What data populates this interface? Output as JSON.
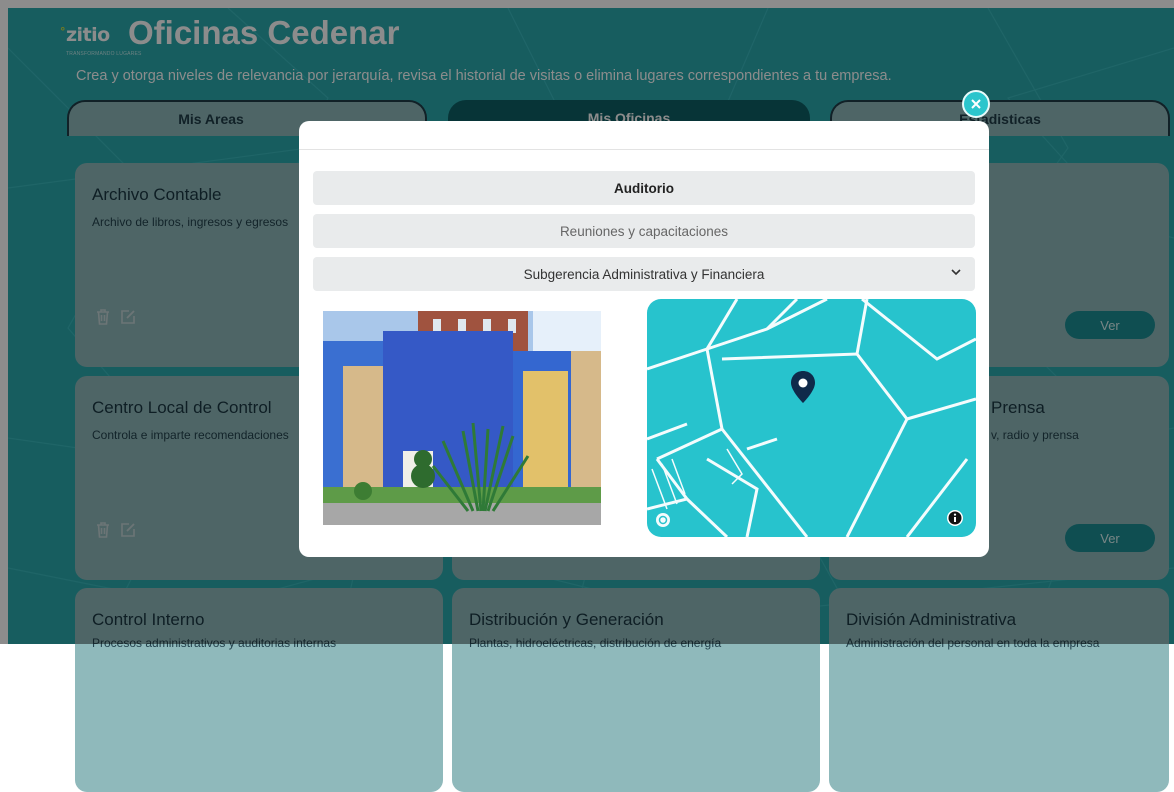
{
  "header": {
    "logo_text": "zitio",
    "logo_dot": "°",
    "logo_tagline": "TRANSFORMANDO LUGARES",
    "title": "Oficinas Cedenar",
    "subtitle": "Crea y otorga niveles de relevancia por jerarquía, revisa el historial de visitas o elimina lugares correspondientes a tu empresa."
  },
  "tabs": [
    {
      "label": "Mis Areas"
    },
    {
      "label": "Mis Oficinas"
    },
    {
      "label": "Estadisticas"
    }
  ],
  "cards": [
    {
      "title": "Archivo Contable",
      "desc": "Archivo de libros, ingresos y egresos"
    },
    {
      "title": "",
      "desc": ""
    },
    {
      "title": "",
      "desc": "",
      "ver": "Ver"
    },
    {
      "title": "Centro Local de Control",
      "desc": "Controla e imparte recomendaciones"
    },
    {
      "title": "",
      "desc": ""
    },
    {
      "title": "Prensa",
      "desc": "v, radio y prensa",
      "ver": "Ver"
    },
    {
      "title": "Control Interno",
      "desc": "Procesos administrativos y auditorias internas"
    },
    {
      "title": "Distribución y Generación",
      "desc": "Plantas, hidroeléctricas, distribución de energía"
    },
    {
      "title": "División Administrativa",
      "desc": "Administración del personal en toda la empresa"
    }
  ],
  "modal": {
    "name_value": "Auditorio",
    "description_value": "Reuniones y capacitaciones",
    "area_selected": "Subgerencia Administrativa y Financiera"
  },
  "icons": {
    "close": "close-icon",
    "trash": "trash-icon",
    "edit": "edit-icon",
    "chevron": "chevron-down-icon",
    "pin": "map-pin-icon",
    "info": "info-icon"
  },
  "colors": {
    "background": "#2aa9ad",
    "card": "#8fb9bb",
    "accent": "#2bc5cc",
    "map": "#27c3cd",
    "button": "#1d8e94"
  }
}
